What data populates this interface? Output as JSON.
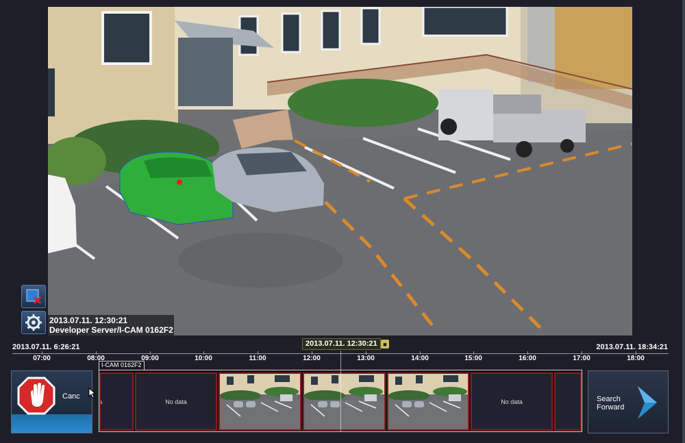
{
  "video": {
    "timestamp": "2013.07.11. 12:30:21",
    "source": "Developer Server/I-CAM 0162F2"
  },
  "side_buttons": {
    "close_icon": "close-stream-icon",
    "settings_icon": "gear-icon"
  },
  "timeline": {
    "start": "2013.07.11. 6:26:21",
    "current": "2013.07.11. 12:30:21",
    "end": "2013.07.11. 18:34:21",
    "ticks": [
      "07:00",
      "08:00",
      "09:00",
      "10:00",
      "11:00",
      "12:00",
      "13:00",
      "14:00",
      "15:00",
      "16:00",
      "17:00",
      "18:00"
    ]
  },
  "strip": {
    "camera_label": "I-CAM 0162F2",
    "frames": [
      {
        "type": "partial",
        "text": "a"
      },
      {
        "type": "nodata",
        "text": "No data"
      },
      {
        "type": "image"
      },
      {
        "type": "image"
      },
      {
        "type": "image"
      },
      {
        "type": "nodata",
        "text": "No data"
      },
      {
        "type": "empty"
      }
    ]
  },
  "buttons": {
    "cancel_label": "Canc",
    "search_label_line1": "Search",
    "search_label_line2": "Forward"
  },
  "colors": {
    "accent": "#2a8bd0",
    "frame_border": "#8b1d1d",
    "stop_red": "#d62828"
  }
}
